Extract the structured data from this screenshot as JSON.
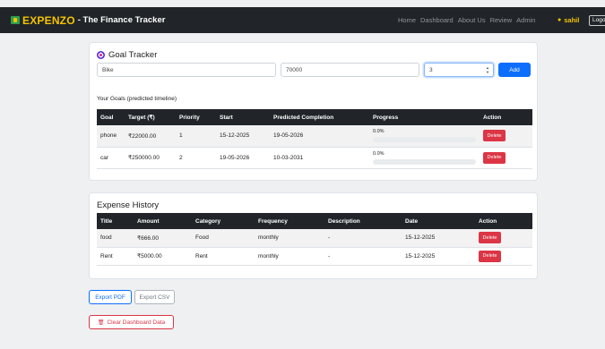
{
  "navbar": {
    "brand": "EXPENZO",
    "subtitle": "- The Finance Tracker",
    "links": [
      "Home",
      "Dashboard",
      "About Us",
      "Review",
      "Admin"
    ],
    "user": "sahil",
    "logout": "Logout"
  },
  "goal_tracker": {
    "title": "Goal Tracker",
    "goal_input_value": "Bike",
    "amount_input_value": "70000",
    "priority_input_value": "3",
    "add_label": "Add",
    "subtitle": "Your Goals (predicted timeline)",
    "columns": [
      "Goal",
      "Target (₹)",
      "Priority",
      "Start",
      "Predicted Completion",
      "Progress",
      "Action"
    ],
    "rows": [
      {
        "goal": "phone",
        "target": "₹22000.00",
        "priority": "1",
        "start": "15-12-2025",
        "completion": "19-05-2026",
        "progress": "0.0%",
        "progress_fraction": 0.0,
        "action": "Delete"
      },
      {
        "goal": "car",
        "target": "₹250000.00",
        "priority": "2",
        "start": "19-05-2026",
        "completion": "10-03-2031",
        "progress": "0.0%",
        "progress_fraction": 0.0,
        "action": "Delete"
      }
    ]
  },
  "expense_history": {
    "title": "Expense History",
    "columns": [
      "Title",
      "Amount",
      "Category",
      "Frequency",
      "Description",
      "Date",
      "Action"
    ],
    "rows": [
      {
        "title": "food",
        "amount": "₹666.00",
        "category": "Food",
        "frequency": "monthly",
        "description": "-",
        "date": "15-12-2025",
        "action": "Delete"
      },
      {
        "title": "Rent",
        "amount": "₹5000.00",
        "category": "Rent",
        "frequency": "monthly",
        "description": "-",
        "date": "15-12-2025",
        "action": "Delete"
      }
    ]
  },
  "actions": {
    "export_pdf": "Export PDF",
    "export_csv": "Export CSV",
    "clear_dashboard": "Clear Dashboard Data"
  },
  "colors": {
    "navbar_bg": "#212529",
    "brand": "#f5c400",
    "primary": "#0d6efd",
    "danger": "#dc3545"
  }
}
